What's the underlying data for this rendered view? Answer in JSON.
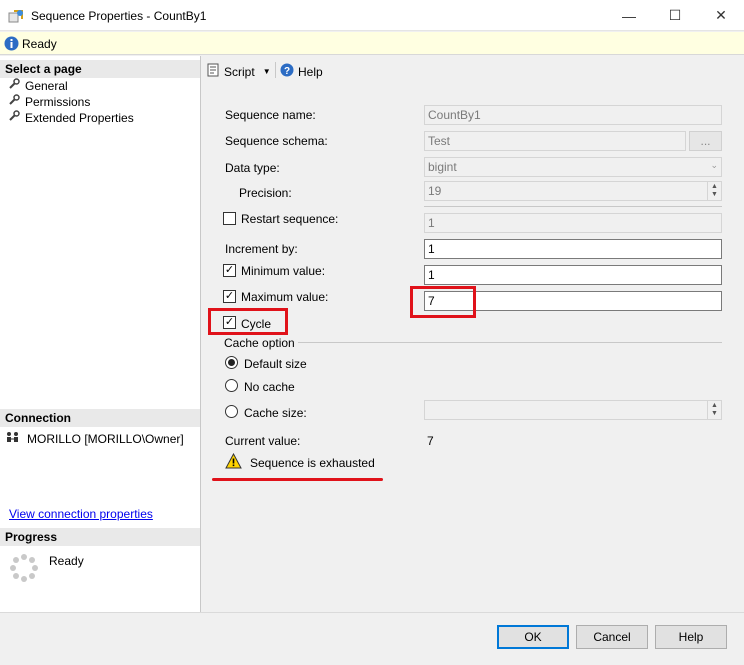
{
  "window": {
    "title": "Sequence Properties - CountBy1",
    "minimize": "—",
    "maximize": "☐",
    "close": "✕"
  },
  "status": {
    "text": "Ready"
  },
  "left": {
    "select_page": "Select a page",
    "pages": [
      "General",
      "Permissions",
      "Extended Properties"
    ],
    "connection_header": "Connection",
    "connection_name": "MORILLO [MORILLO\\Owner]",
    "view_connection": "View connection properties",
    "progress_header": "Progress",
    "progress_status": "Ready"
  },
  "toolbar": {
    "script": "Script",
    "help": "Help"
  },
  "form": {
    "sequence_name_label": "Sequence name:",
    "sequence_name_value": "CountBy1",
    "sequence_schema_label": "Sequence schema:",
    "sequence_schema_value": "Test",
    "schema_browse": "...",
    "data_type_label": "Data type:",
    "data_type_value": "bigint",
    "precision_label": "Precision:",
    "precision_value": "19",
    "restart_label": "Restart sequence:",
    "restart_checked": false,
    "restart_value": "1",
    "increment_label": "Increment by:",
    "increment_value": "1",
    "min_label": "Minimum value:",
    "min_checked": true,
    "min_value": "1",
    "max_label": "Maximum value:",
    "max_checked": true,
    "max_value": "7",
    "cycle_label": "Cycle",
    "cycle_checked": true,
    "cache_option_label": "Cache option",
    "cache_default": "Default size",
    "cache_none": "No cache",
    "cache_size": "Cache size:",
    "cache_size_value": "",
    "cache_selected": "Default size",
    "current_value_label": "Current value:",
    "current_value": "7",
    "warning_text": "Sequence is exhausted"
  },
  "buttons": {
    "ok": "OK",
    "cancel": "Cancel",
    "help": "Help"
  },
  "colors": {
    "highlight": "#e0121a",
    "accent": "#0078d7"
  }
}
